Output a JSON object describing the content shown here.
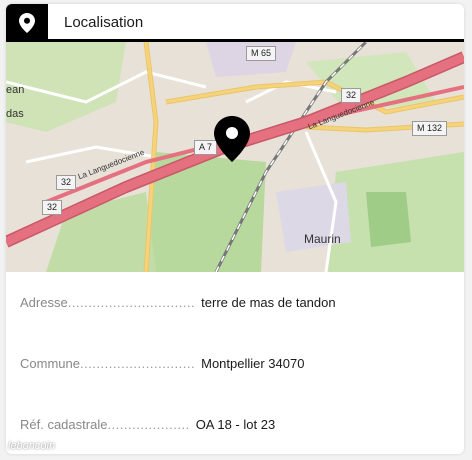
{
  "header": {
    "title": "Localisation",
    "icon": "location-pin-icon"
  },
  "map": {
    "place_labels": [
      "Maurin"
    ],
    "road_names": [
      "La Languedocienne",
      "La Languedocienne"
    ],
    "road_shields": [
      "A 7",
      "M 65",
      "M 132",
      "32",
      "32",
      "32"
    ],
    "partial_text": [
      "ean",
      "das"
    ],
    "marker_icon": "map-marker-icon"
  },
  "details": [
    {
      "label": "Adresse",
      "dots": "...............................",
      "value": "terre de mas de tandon"
    },
    {
      "label": "Commune",
      "dots": "............................",
      "value": "Montpellier 34070"
    },
    {
      "label": "Réf. cadastrale",
      "dots": "....................",
      "value": "OA 18 - lot 23"
    }
  ],
  "watermark": "leboncoin",
  "colors": {
    "header_accent": "#000000",
    "highway": "#e5707f",
    "secondary_road": "#f6d27a",
    "greenery": "#b8d99e",
    "urban": "#e3dcd3"
  }
}
